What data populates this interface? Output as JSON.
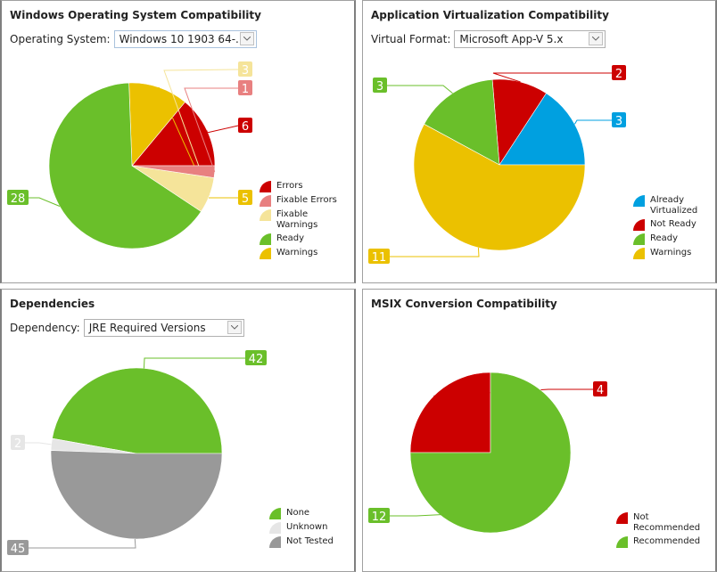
{
  "panels": [
    {
      "title": "Windows Operating System Compatibility",
      "selector": {
        "label": "Operating System:",
        "value": "Windows 10 1903 64-..."
      },
      "chart_data": {
        "type": "pie",
        "title": "Windows Operating System Compatibility",
        "slices": [
          {
            "name": "Errors",
            "value": 6,
            "color": "#cc0000"
          },
          {
            "name": "Warnings",
            "value": 5,
            "color": "#ebc100"
          },
          {
            "name": "Ready",
            "value": 28,
            "color": "#6abf2a"
          },
          {
            "name": "Fixable Warnings",
            "value": 3,
            "color": "#f5e49a"
          },
          {
            "name": "Fixable Errors",
            "value": 1,
            "color": "#e88080"
          }
        ],
        "legend": [
          "Errors",
          "Fixable Errors",
          "Fixable Warnings",
          "Ready",
          "Warnings"
        ],
        "legend_position": "bottom-right"
      }
    },
    {
      "title": "Application Virtualization Compatibility",
      "selector": {
        "label": "Virtual Format:",
        "value": "Microsoft App-V 5.x"
      },
      "chart_data": {
        "type": "pie",
        "title": "Application Virtualization Compatibility",
        "slices": [
          {
            "name": "Already Virtualized",
            "value": 3,
            "color": "#00a0e0"
          },
          {
            "name": "Not Ready",
            "value": 2,
            "color": "#cc0000"
          },
          {
            "name": "Ready",
            "value": 3,
            "color": "#6abf2a"
          },
          {
            "name": "Warnings",
            "value": 11,
            "color": "#ebc100"
          }
        ],
        "legend": [
          "Already Virtualized",
          "Not Ready",
          "Ready",
          "Warnings"
        ],
        "legend_position": "bottom-right"
      }
    },
    {
      "title": "Dependencies",
      "selector": {
        "label": "Dependency:",
        "value": "JRE Required Versions"
      },
      "chart_data": {
        "type": "pie",
        "title": "Dependencies",
        "slices": [
          {
            "name": "None",
            "value": 42,
            "color": "#6abf2a"
          },
          {
            "name": "Unknown",
            "value": 2,
            "color": "#e6e6e6"
          },
          {
            "name": "Not Tested",
            "value": 45,
            "color": "#999999"
          }
        ],
        "legend": [
          "None",
          "Unknown",
          "Not Tested"
        ],
        "legend_position": "bottom-right"
      }
    },
    {
      "title": "MSIX Conversion Compatibility",
      "selector": null,
      "chart_data": {
        "type": "pie",
        "title": "MSIX Conversion Compatibility",
        "slices": [
          {
            "name": "Not Recommended",
            "value": 4,
            "color": "#cc0000"
          },
          {
            "name": "Recommended",
            "value": 12,
            "color": "#6abf2a"
          }
        ],
        "legend": [
          "Not Recommended",
          "Recommended"
        ],
        "legend_position": "bottom-right"
      }
    }
  ],
  "icons": {
    "dropdown": "chevron-down-icon"
  }
}
